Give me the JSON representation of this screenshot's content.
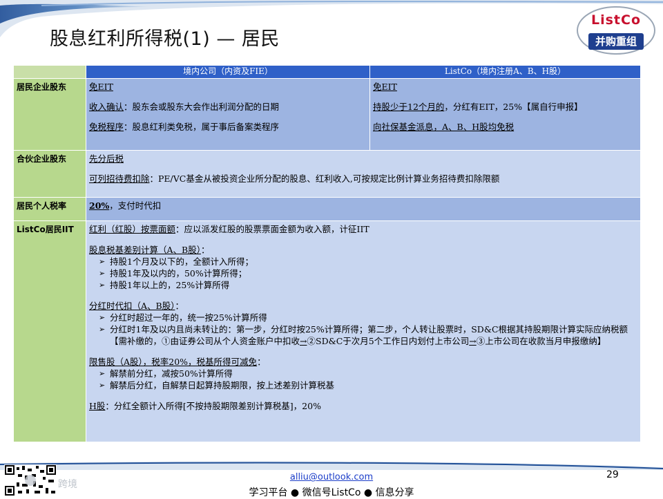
{
  "title": "股息红利所得税(1) — 居民",
  "logo": {
    "top": "ListCo",
    "bottom": "并购重组"
  },
  "table": {
    "headers": [
      "境内公司（内资及FIE）",
      "ListCo（境内注册A、B、H股）"
    ],
    "rows": [
      {
        "label": "居民企业股东",
        "domestic": {
          "l1": "免EIT",
          "l2_u": "收入确认",
          "l2": "：股东会或股东大会作出利润分配的日期",
          "l3_u": "免税程序",
          "l3": "：股息红利类免税，属于事后备案类程序"
        },
        "listco": {
          "l1": "免EIT",
          "l2_u": "持股少于12个月的",
          "l2": "，分红有EIT，25%【属自行申报】",
          "l3": "向社保基金派息，A、B、H股均免税"
        }
      },
      {
        "label": "合伙企业股东",
        "l1": "先分后税",
        "l2_u": "可列招待费扣除",
        "l2": "：PE/VC基金从被投资企业所分配的股息、红利收入,可按规定比例计算业务招待费扣除限额"
      },
      {
        "label": "居民个人税率",
        "rate": "20%",
        "text": "，支付时代扣"
      },
      {
        "label": "ListCo居民IIT",
        "s1_u": "红利（红股）按票面额",
        "s1": "：应以派发红股的股票票面金额为收入额，计征IIT",
        "s2_title": "股息税基差别计算（A、B股）",
        "s2_colon": "：",
        "s2_bullets": [
          "持股1个月及以下的，全额计入所得；",
          "持股1年及以内的，50%计算所得；",
          "持股1年以上的，25%计算所得"
        ],
        "s3_title": "分红时代扣（A、B股）",
        "s3_colon": "：",
        "s3_b1": "分红时超过一年的，统一按25%计算所得",
        "s3_b2_a": "分红时1年及以内且尚未转让的：第一步，分红时按25%计算所得；第二步，个人转让股票时，SD&C根据其持股期限计算实际应纳税额【需补缴的，①由证券公司从个人资金账户中扣收",
        "s3_b2_arrow1": "→",
        "s3_b2_b": "②SD&C于次月5个工作日内划付上市公司",
        "s3_b2_arrow2": "→",
        "s3_b2_c": "③上市公司在收款当月申报缴纳】",
        "s4_title": "限售股（A股），税率20%，税基所得可减免",
        "s4_colon": "：",
        "s4_bullets": [
          "解禁前分红，减按50%计算所得",
          "解禁后分红，自解禁日起算持股期限，按上述差别计算税基"
        ],
        "s5_u": "H股",
        "s5": "：分红全额计入所得[不按持股期限差别计算税基]，20%"
      }
    ]
  },
  "footer": {
    "watermark": "跨境",
    "email": "alliu@outlook.com",
    "share": "学习平台 ● 微信号ListCo ● 信息分享",
    "page": "29"
  },
  "colors": {
    "header_blue": "#2f60c8",
    "label_green": "#b7d88d",
    "cell_dark": "#9db4e1",
    "cell_light": "#c8d6f0",
    "logo_red": "#c8102e",
    "logo_blue": "#1f3f8f"
  }
}
